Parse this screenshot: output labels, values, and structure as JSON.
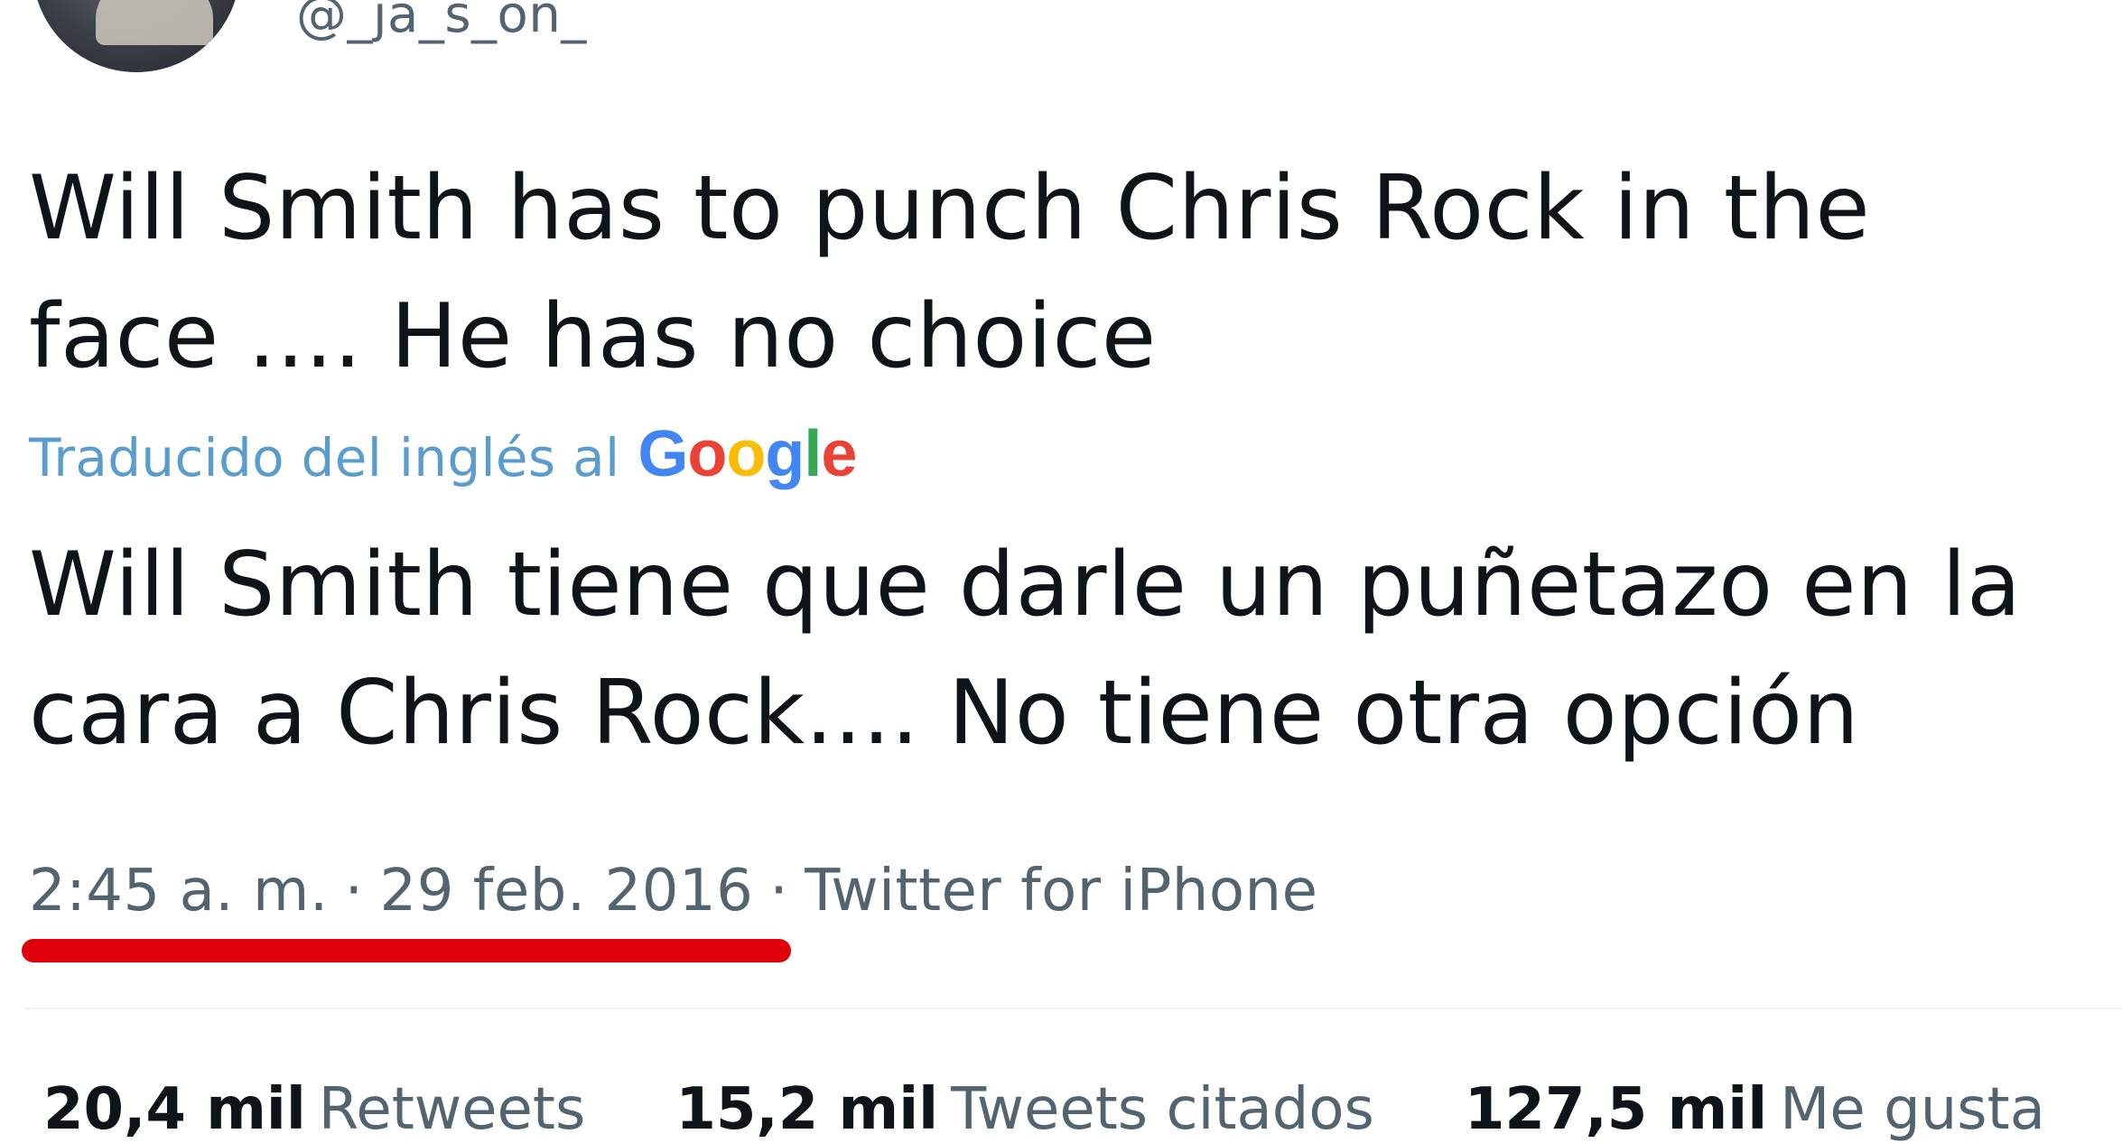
{
  "author": {
    "handle": "@_ja_s_on_"
  },
  "tweet": {
    "text_lines": [
      "Will Smith has to punch Chris Rock in the",
      "face .... He has no choice"
    ],
    "translation_label": "Traducido del inglés al",
    "translation_provider": {
      "letters": [
        "G",
        "o",
        "o",
        "g",
        "l",
        "e"
      ],
      "colors": [
        "#4285F4",
        "#EA4335",
        "#FBBC05",
        "#4285F4",
        "#34A853",
        "#EA4335"
      ]
    },
    "translated_lines": [
      "Will Smith tiene que darle un puñetazo en la",
      "cara a Chris Rock.... No tiene otra opción"
    ]
  },
  "meta": {
    "time": "2:45 a. m.",
    "separator": "·",
    "date": "29 feb. 2016",
    "source": "Twitter for iPhone",
    "highlight_color": "#e0000a"
  },
  "stats": [
    {
      "count": "20,4 mil",
      "label": "Retweets"
    },
    {
      "count": "15,2 mil",
      "label": "Tweets citados"
    },
    {
      "count": "127,5 mil",
      "label": "Me gusta"
    }
  ]
}
